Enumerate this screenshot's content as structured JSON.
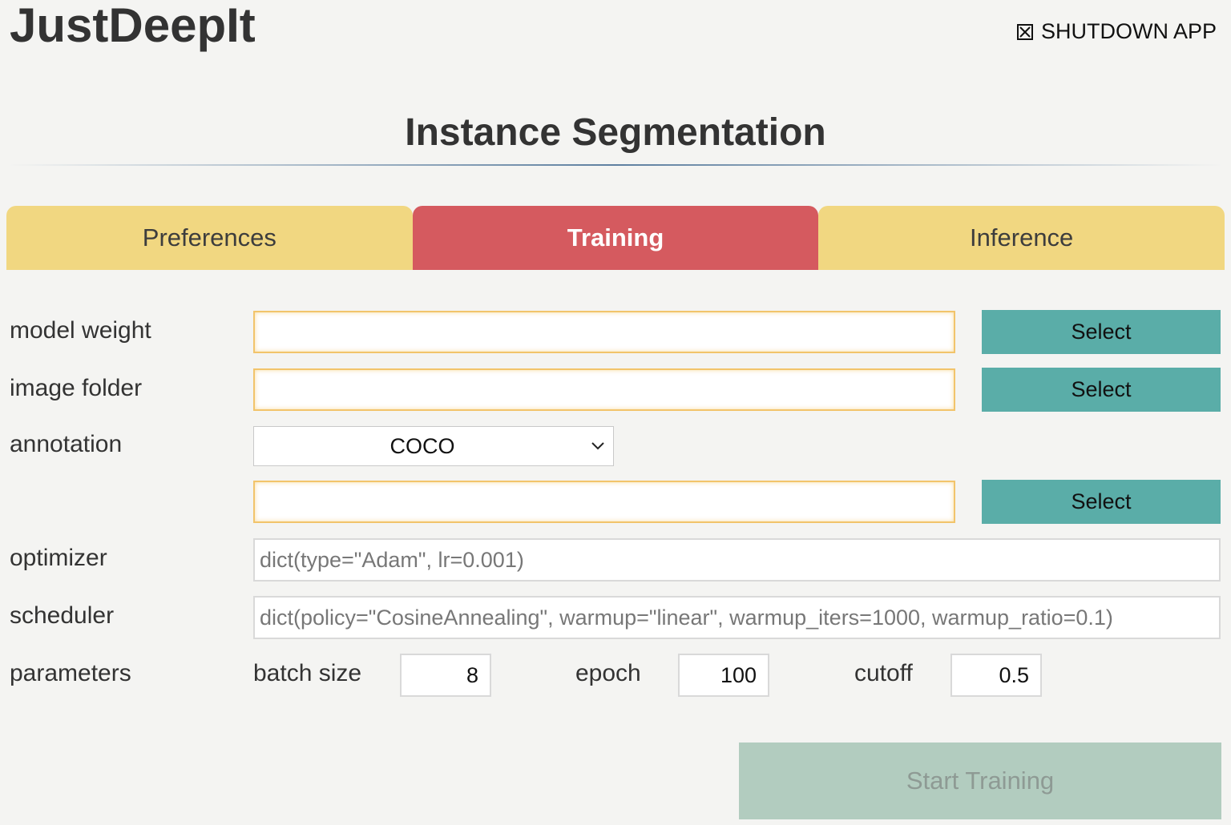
{
  "app": {
    "title": "JustDeepIt",
    "shutdown_label": "SHUTDOWN APP"
  },
  "page": {
    "heading": "Instance Segmentation"
  },
  "tabs": [
    {
      "label": "Preferences",
      "active": false
    },
    {
      "label": "Training",
      "active": true
    },
    {
      "label": "Inference",
      "active": false
    }
  ],
  "form": {
    "model_weight": {
      "label": "model weight",
      "value": "",
      "button": "Select"
    },
    "image_folder": {
      "label": "image folder",
      "value": "",
      "button": "Select"
    },
    "annotation": {
      "label": "annotation",
      "format": "COCO",
      "path_value": "",
      "button": "Select"
    },
    "optimizer": {
      "label": "optimizer",
      "placeholder": "dict(type=\"Adam\", lr=0.001)"
    },
    "scheduler": {
      "label": "scheduler",
      "placeholder": "dict(policy=\"CosineAnnealing\", warmup=\"linear\", warmup_iters=1000, warmup_ratio=0.1)"
    },
    "parameters": {
      "label": "parameters",
      "batch_size_label": "batch size",
      "batch_size": "8",
      "epoch_label": "epoch",
      "epoch": "100",
      "cutoff_label": "cutoff",
      "cutoff": "0.5"
    }
  },
  "actions": {
    "start_training": "Start Training",
    "start_training_enabled": false
  },
  "colors": {
    "tab_inactive": "#f1d781",
    "tab_active": "#d55a5f",
    "select_button": "#5aada8",
    "input_border_highlight": "#f2c46b",
    "start_button_disabled": "#b2ccbf"
  }
}
